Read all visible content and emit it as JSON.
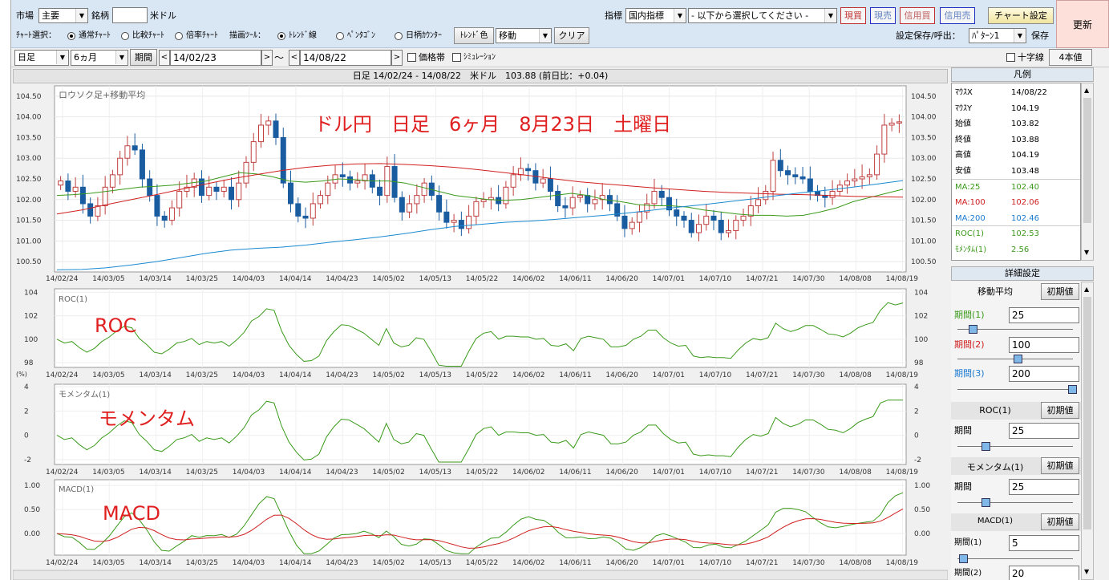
{
  "toolbar": {
    "market_label": "市場",
    "market_value": "主要",
    "symbol_label": "銘柄",
    "symbol_value": "米ドル",
    "indicator_label": "指標",
    "indicator_value": "国内指標",
    "indicator_select": "- 以下から選択してください -",
    "btn_buy_spot": "現買",
    "btn_sell_spot": "現売",
    "btn_buy_margin": "信用買",
    "btn_sell_margin": "信用売",
    "chart_settings": "チャート設定",
    "refresh": "更新",
    "chart_select_label": "ﾁｬｰﾄ選択：",
    "chart_opt1": "通常ﾁｬｰﾄ",
    "chart_opt2": "比較ﾁｬｰﾄ",
    "chart_opt3": "倍率ﾁｬｰﾄ",
    "draw_tool_label": "描画ﾂｰﾙ：",
    "draw_opt1": "ﾄﾚﾝﾄﾞ線",
    "draw_opt2": "ﾍﾟﾝﾀｺﾞﾝ",
    "draw_opt3": "日柄ｶｳﾝﾀｰ",
    "trend_color": "ﾄﾚﾝﾄﾞ色",
    "move_value": "移動",
    "clear": "クリア",
    "save_label": "設定保存/呼出：",
    "pattern_value": "ﾊﾟﾀｰﾝ1",
    "save_btn": "保存",
    "period_type": "日足",
    "period_range": "6ヵ月",
    "period_btn": "期間",
    "date_from": "14/02/23",
    "date_to": "14/08/22",
    "tilde": "～",
    "price_band": "価格帯",
    "simulation": "ｼﾐｭﾚｰｼｮﾝ",
    "crosshair": "十字線",
    "four_values": "4本値"
  },
  "header": {
    "text": "日足 14/02/24 - 14/08/22　米ドル　103.88 (前日比：+0.04)"
  },
  "panels": {
    "main_label": "ロウソク足+移動平均",
    "annotation": "ドル円　日足　6ヶ月　8月23日　土曜日",
    "roc_label": "ROC(1)",
    "roc_annot": "ROC",
    "mom_label": "モメンタム(1)",
    "mom_annot": "モメンタム",
    "macd_label": "MACD(1)",
    "macd_annot": "MACD",
    "pct_unit": "(%)"
  },
  "chart_data": {
    "type": "candlestick",
    "x_ticks": [
      "14/02/24",
      "14/03/05",
      "14/03/14",
      "14/03/25",
      "14/04/03",
      "14/04/14",
      "14/04/23",
      "14/05/02",
      "14/05/13",
      "14/05/22",
      "14/06/02",
      "14/06/11",
      "14/06/20",
      "14/07/01",
      "14/07/10",
      "14/07/21",
      "14/07/30",
      "14/08/08",
      "14/08/19"
    ],
    "y_ticks_main": [
      "104.50",
      "104.00",
      "103.50",
      "103.00",
      "102.50",
      "102.00",
      "101.50",
      "101.00",
      "100.50"
    ],
    "ylim_main": [
      100.25,
      104.75
    ],
    "close": [
      102.45,
      102.2,
      102.3,
      101.9,
      101.6,
      101.85,
      102.3,
      102.6,
      103.0,
      103.3,
      103.2,
      102.5,
      102.1,
      101.6,
      101.5,
      101.8,
      102.2,
      102.3,
      102.5,
      102.1,
      102.3,
      102.2,
      102.3,
      102.0,
      102.4,
      102.9,
      103.4,
      103.8,
      103.9,
      103.5,
      102.4,
      101.9,
      101.6,
      101.55,
      101.9,
      102.1,
      102.4,
      102.6,
      102.55,
      102.4,
      102.45,
      102.6,
      102.3,
      102.1,
      102.8,
      102.05,
      101.7,
      101.9,
      102.1,
      102.4,
      102.1,
      101.7,
      101.45,
      101.5,
      101.3,
      101.6,
      101.95,
      102.0,
      102.05,
      101.9,
      102.3,
      102.6,
      102.75,
      102.7,
      102.4,
      102.5,
      102.2,
      101.85,
      101.8,
      102.05,
      102.1,
      101.9,
      102.0,
      102.1,
      101.9,
      101.6,
      101.3,
      101.45,
      101.7,
      101.9,
      102.2,
      102.05,
      101.75,
      101.6,
      101.5,
      101.2,
      101.4,
      101.6,
      101.5,
      101.2,
      101.25,
      101.5,
      101.6,
      101.85,
      102.0,
      102.2,
      102.95,
      102.7,
      102.6,
      102.55,
      102.5,
      102.2,
      102.1,
      102.05,
      102.2,
      102.35,
      102.45,
      102.5,
      102.55,
      102.6,
      103.1,
      103.8,
      103.85,
      103.88
    ],
    "ma25": [
      102.1,
      102.12,
      102.15,
      102.2,
      102.25,
      102.3,
      102.32,
      102.35,
      102.4,
      102.45,
      102.55,
      102.65,
      102.62,
      102.55,
      102.45,
      102.42,
      102.45,
      102.5,
      102.48,
      102.45,
      102.45,
      102.4,
      102.3,
      102.2,
      102.1,
      102.05,
      102.0,
      101.98,
      102.0,
      102.05,
      102.1,
      102.15,
      102.1,
      102.0,
      101.95,
      101.88,
      101.85,
      101.85,
      101.82,
      101.75,
      101.7,
      101.65,
      101.62,
      101.62,
      101.6,
      101.62,
      101.7,
      101.8,
      101.95,
      102.05,
      102.15,
      102.25
    ],
    "ma100": [
      101.65,
      101.75,
      101.88,
      102.0,
      102.12,
      102.25,
      102.38,
      102.5,
      102.6,
      102.7,
      102.78,
      102.83,
      102.86,
      102.87,
      102.85,
      102.82,
      102.78,
      102.72,
      102.65,
      102.58,
      102.5,
      102.43,
      102.38,
      102.33,
      102.28,
      102.24,
      102.2,
      102.17,
      102.15,
      102.13,
      102.12,
      102.1,
      102.08,
      102.07,
      102.06
    ],
    "ma200": [
      100.3,
      100.31,
      100.35,
      100.42,
      100.5,
      100.6,
      100.7,
      100.78,
      100.82,
      100.85,
      100.9,
      100.97,
      101.03,
      101.1,
      101.18,
      101.27,
      101.35,
      101.4,
      101.45,
      101.48,
      101.52,
      101.57,
      101.62,
      101.68,
      101.75,
      101.82,
      101.88,
      101.95,
      102.02,
      102.1,
      102.17,
      102.23,
      102.3,
      102.38,
      102.46
    ],
    "y_ticks_roc": [
      "104",
      "102",
      "100",
      "98"
    ],
    "y_ticks_mom": [
      "4",
      "2",
      "0",
      "-2"
    ],
    "y_ticks_macd": [
      "1.00",
      "0.50",
      "0.00"
    ]
  },
  "legend": {
    "title": "凡例",
    "rows": [
      {
        "k": "ﾏｳｽX",
        "v": "14/08/22",
        "c": "#000000"
      },
      {
        "k": "ﾏｳｽY",
        "v": "104.19",
        "c": "#000000"
      },
      {
        "k": "始値",
        "v": "103.82",
        "c": "#000000"
      },
      {
        "k": "終値",
        "v": "103.88",
        "c": "#000000"
      },
      {
        "k": "高値",
        "v": "104.19",
        "c": "#000000"
      },
      {
        "k": "安値",
        "v": "103.48",
        "c": "#000000"
      },
      {
        "k": "MA:25",
        "v": "102.40",
        "c": "#3a9a1a"
      },
      {
        "k": "MA:100",
        "v": "102.06",
        "c": "#d02020"
      },
      {
        "k": "MA:200",
        "v": "102.46",
        "c": "#1a7ad0"
      },
      {
        "k": "ROC(1)",
        "v": "102.53",
        "c": "#3a9a1a"
      },
      {
        "k": "ﾓﾒﾝﾀﾑ(1)",
        "v": "2.56",
        "c": "#3a9a1a"
      }
    ]
  },
  "detail": {
    "title": "詳細設定",
    "ma_title": "移動平均",
    "reset": "初期値",
    "p1_label": "期間(1)",
    "p1": "25",
    "p2_label": "期間(2)",
    "p2": "100",
    "p3_label": "期間(3)",
    "p3": "200",
    "roc_title": "ROC(1)",
    "roc_period_label": "期間",
    "roc_period": "25",
    "mom_title": "モメンタム(1)",
    "mom_period_label": "期間",
    "mom_period": "25",
    "macd_title": "MACD(1)",
    "macd_p1_label": "期間(1)",
    "macd_p1": "5",
    "macd_p2_label": "期間(2)",
    "macd_p2": "20"
  }
}
